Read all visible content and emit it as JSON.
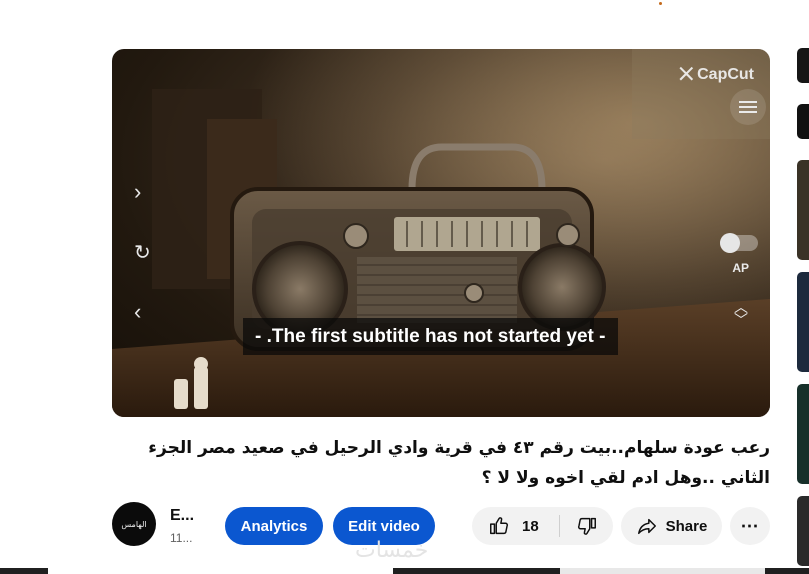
{
  "player": {
    "watermark": "CapCut",
    "subtitle": "- .The first subtitle has not started yet -",
    "autoplay_label": "AP"
  },
  "video": {
    "title": "رعب عودة سلهام..بيت رقم ٤٣ في قرية وادي الرحيل في صعيد مصر الجزء الثاني ..وهل ادم لقي اخوه ولا لا ؟"
  },
  "channel": {
    "name": "E...",
    "subscribers": "11...",
    "avatar_text": "الهامس"
  },
  "actions": {
    "analytics_label": "Analytics",
    "edit_label": "Edit video",
    "like_count": "18",
    "share_label": "Share",
    "more_label": "⋯"
  },
  "background_watermark": "خمسات",
  "colors": {
    "primary_button": "#0b57d0",
    "secondary_button": "#f2f2f2"
  }
}
